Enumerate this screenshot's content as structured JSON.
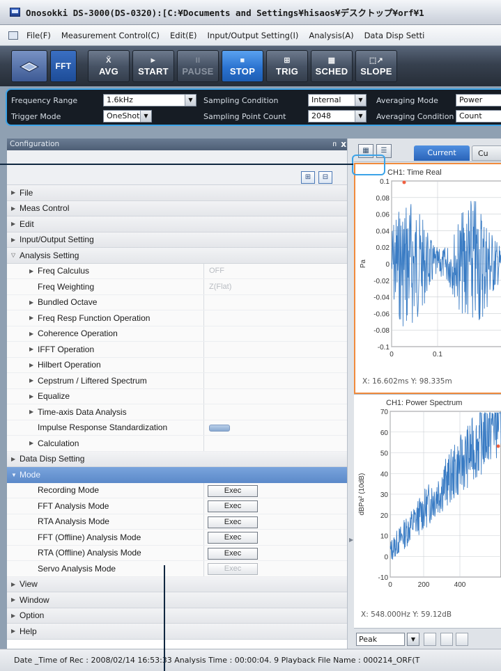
{
  "window": {
    "title": "Onosokki DS-3000(DS-0320):[C:¥Documents and Settings¥hisaos¥デスクトップ¥orf¥1"
  },
  "menu": {
    "items": [
      "File(F)",
      "Measurement Control(C)",
      "Edit(E)",
      "Input/Output Setting(I)",
      "Analysis(A)",
      "Data Disp Setti"
    ]
  },
  "toolbar": {
    "fft": "FFT",
    "avg": {
      "glyph": "X̄",
      "label": "AVG"
    },
    "start": {
      "glyph": "►",
      "label": "START"
    },
    "pause": {
      "glyph": "II",
      "label": "PAUSE"
    },
    "stop": {
      "glyph": "■",
      "label": "STOP"
    },
    "trig": {
      "glyph": "⊞",
      "label": "TRIG"
    },
    "sched": {
      "glyph": "▦",
      "label": "SCHED"
    },
    "slope": {
      "glyph": "⬚↗",
      "label": "SLOPE"
    }
  },
  "settings": {
    "frequency_range_label": "Frequency Range",
    "frequency_range_value": "1.6kHz",
    "sampling_condition_label": "Sampling Condition",
    "sampling_condition_value": "Internal",
    "averaging_mode_label": "Averaging Mode",
    "averaging_mode_value": "Power",
    "trigger_mode_label": "Trigger Mode",
    "trigger_mode_value": "OneShot",
    "sampling_point_count_label": "Sampling Point Count",
    "sampling_point_count_value": "2048",
    "averaging_condition_label": "Averaging Condition",
    "averaging_condition_value": "Count"
  },
  "config": {
    "title": "Configuration",
    "pin": "ᴨ",
    "close": "x",
    "top_items": [
      "File",
      "Meas Control",
      "Edit",
      "Input/Output Setting"
    ],
    "analysis_setting": "Analysis Setting",
    "analysis_items": [
      {
        "label": "Freq Calculus",
        "value": "OFF"
      },
      {
        "label": "Freq Weighting",
        "value": "Z(Flat)"
      },
      {
        "label": "Bundled Octave",
        "value": ""
      },
      {
        "label": "Freq Resp Function Operation",
        "value": ""
      },
      {
        "label": "Coherence Operation",
        "value": ""
      },
      {
        "label": "IFFT Operation",
        "value": ""
      },
      {
        "label": "Hilbert Operation",
        "value": ""
      },
      {
        "label": "Cepstrum / Liftered Spectrum",
        "value": ""
      },
      {
        "label": "Equalize",
        "value": ""
      },
      {
        "label": "Time-axis Data Analysis",
        "value": ""
      },
      {
        "label": "Impulse Response Standardization",
        "value": ""
      },
      {
        "label": "Calculation",
        "value": ""
      }
    ],
    "data_disp_setting": "Data Disp Setting",
    "mode": "Mode",
    "mode_items": [
      {
        "label": "Recording Mode",
        "button": "Exec"
      },
      {
        "label": "FFT Analysis Mode",
        "button": "Exec"
      },
      {
        "label": "RTA Analysis Mode",
        "button": "Exec"
      },
      {
        "label": "FFT (Offline) Analysis Mode",
        "button": "Exec"
      },
      {
        "label": "RTA (Offline) Analysis Mode",
        "button": "Exec"
      },
      {
        "label": "Servo Analysis Mode",
        "button": "Exec"
      }
    ],
    "bottom_items": [
      "View",
      "Window",
      "Option",
      "Help"
    ]
  },
  "graph_area": {
    "tab_current": "Current",
    "tab_other": "Cu",
    "peak_select": "Peak",
    "chart1_cursor": "X: 16.602ms  Y: 98.335m",
    "chart2_cursor": "X: 548.000Hz  Y: 59.12dB"
  },
  "chart_data": [
    {
      "type": "line",
      "title": "CH1: Time Real",
      "ylabel": "Pa",
      "xlabel": "",
      "ylim": [
        -0.1,
        0.1
      ],
      "yticks": [
        "0.1",
        "0.08",
        "0.06",
        "0.04",
        "0.02",
        "0",
        "-0.02",
        "-0.04",
        "-0.06",
        "-0.08",
        "-0.1"
      ],
      "xticks": [
        "0",
        "0.1"
      ],
      "series_color": "#3a7cc4"
    },
    {
      "type": "line",
      "title": "CH1: Power Spectrum",
      "ylabel": "dBPa² (10dB)",
      "xlabel": "",
      "ylim": [
        -10,
        70
      ],
      "yticks": [
        "70",
        "60",
        "50",
        "40",
        "30",
        "20",
        "10",
        "0",
        "-10"
      ],
      "xticks": [
        "0",
        "200",
        "400"
      ],
      "series_color": "#3a7cc4"
    }
  ],
  "status": {
    "text": "Date _Time of Rec : 2008/02/14 16:53:33    Analysis Time : 00:00:04. 9    Playback File Name : 000214_ORF(T"
  },
  "colors": {
    "accent": "#3ba3e8",
    "stop_active": "#2b73d0",
    "mode_row": "#5b89c9",
    "plot_line": "#3a7cc4",
    "panel_highlight": "#f08a3c"
  }
}
